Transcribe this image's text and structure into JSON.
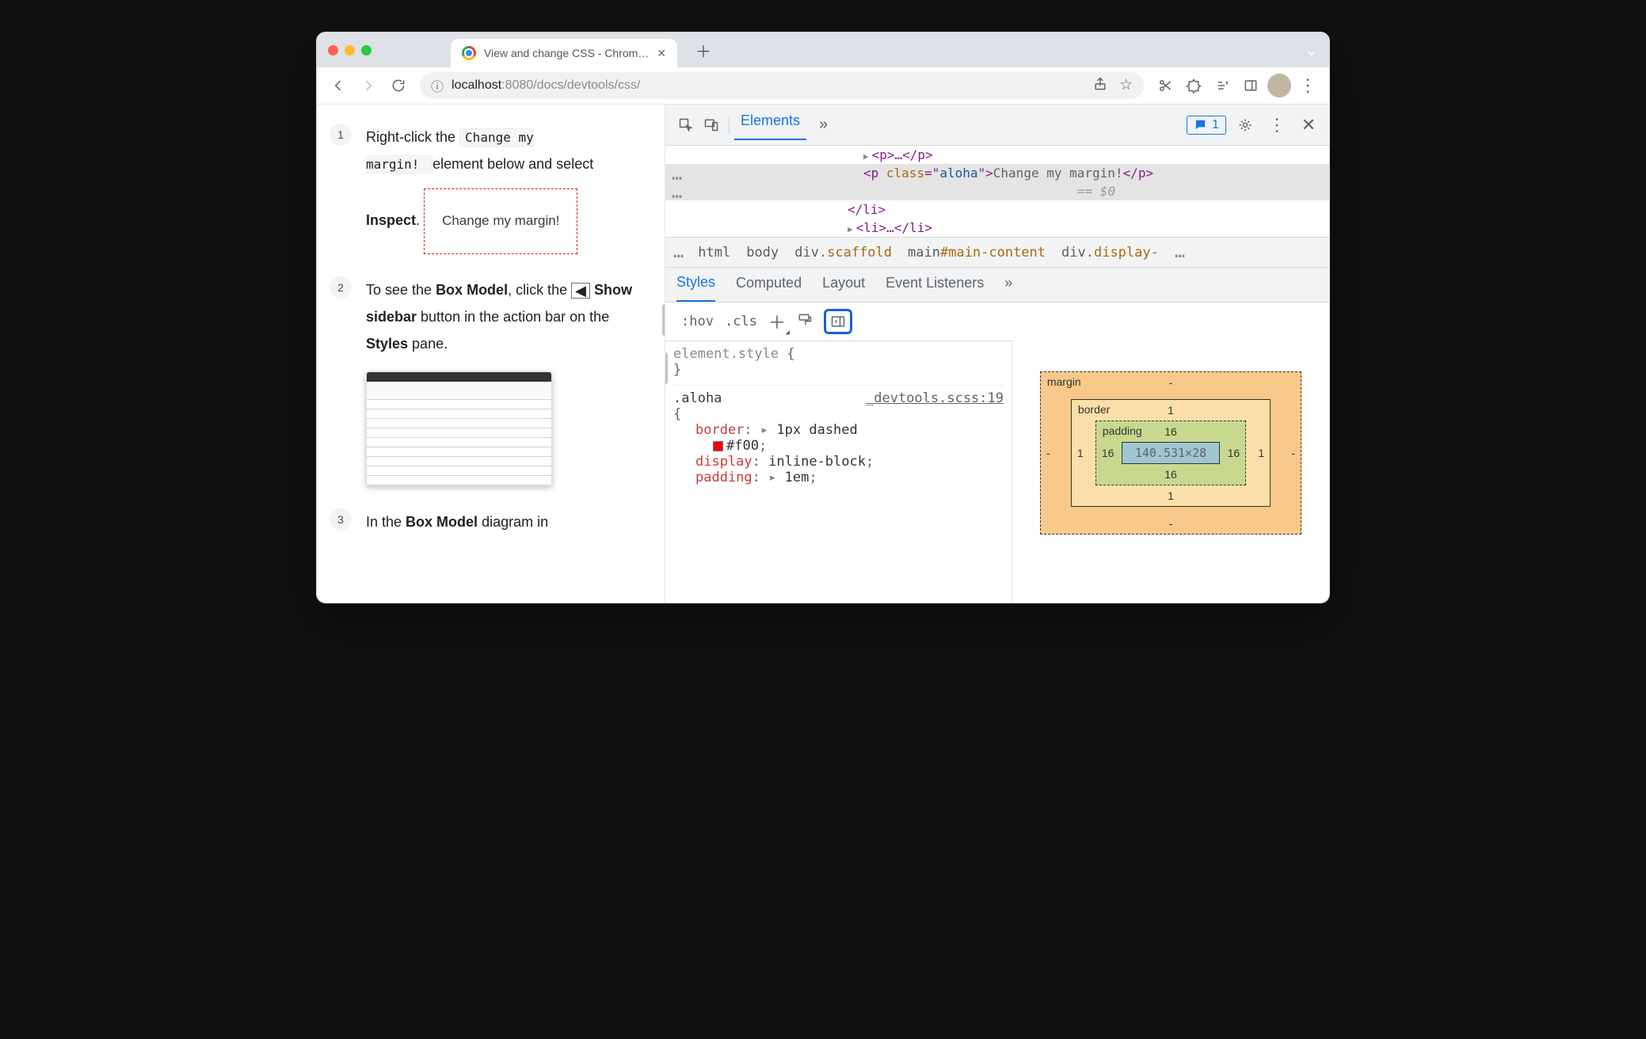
{
  "browser": {
    "tab_title": "View and change CSS - Chrom…",
    "url_host_prefix": "localhost",
    "url_port": ":8080",
    "url_path": "/docs/devtools/css/",
    "new_tab_glyph": "＋",
    "chevron": "⌄"
  },
  "page": {
    "steps": {
      "s1": {
        "num": "1",
        "p1_a": "Right-click the ",
        "p1_codeL1": "Change my",
        "p1_codeL2": "margin!",
        "p1_b": " element below and select ",
        "p1_bold": "Inspect",
        "p1_c": ".",
        "box_text": "Change my margin!"
      },
      "s2": {
        "num": "2",
        "a": "To see the ",
        "bold1": "Box Model",
        "b": ", click the ",
        "sb_glyph": "◀",
        "bold2": " Show sidebar",
        "c": " button in the action bar on the ",
        "bold3": "Styles",
        "d": " pane."
      },
      "s3": {
        "num": "3",
        "a": "In the ",
        "bold1": "Box Model",
        "b": " diagram in"
      }
    }
  },
  "devtools": {
    "header": {
      "tab_elements": "Elements",
      "more": "»",
      "feedback_count": "1"
    },
    "dom": {
      "l1": "<p>…</p>",
      "l2_open": "<p ",
      "l2_attr": "class",
      "l2_eq": "=\"",
      "l2_val": "aloha",
      "l2_close_attr": "\">",
      "l2_text": "Change my margin!",
      "l2_close": "</p>",
      "l2b": "== $0",
      "l3": "</li>",
      "l4": "<li>…</li>"
    },
    "breadcrumb": [
      "html",
      "body",
      "div.scaffold",
      "main#main-content",
      "div.display-"
    ],
    "subtabs": {
      "styles": "Styles",
      "computed": "Computed",
      "layout": "Layout",
      "events": "Event Listeners",
      "more": "»"
    },
    "action": {
      "hov": ":hov",
      "cls": ".cls"
    },
    "css": {
      "es_sel": "element.style ",
      "es_brace_open": "{",
      "es_brace_close": "}",
      "rule_sel": ".aloha",
      "rule_src": "_devtools.scss:19",
      "brace_open": "{",
      "p1": "border",
      "v1a": "1px dashed",
      "v1b": "#f00",
      "p2": "display",
      "v2": "inline-block",
      "p3": "padding",
      "v3": "1em"
    },
    "box": {
      "margin_label": "margin",
      "margin": "-",
      "border_label": "border",
      "border": "1",
      "padding_label": "padding",
      "padding": "16",
      "content": "140.531×28"
    }
  }
}
